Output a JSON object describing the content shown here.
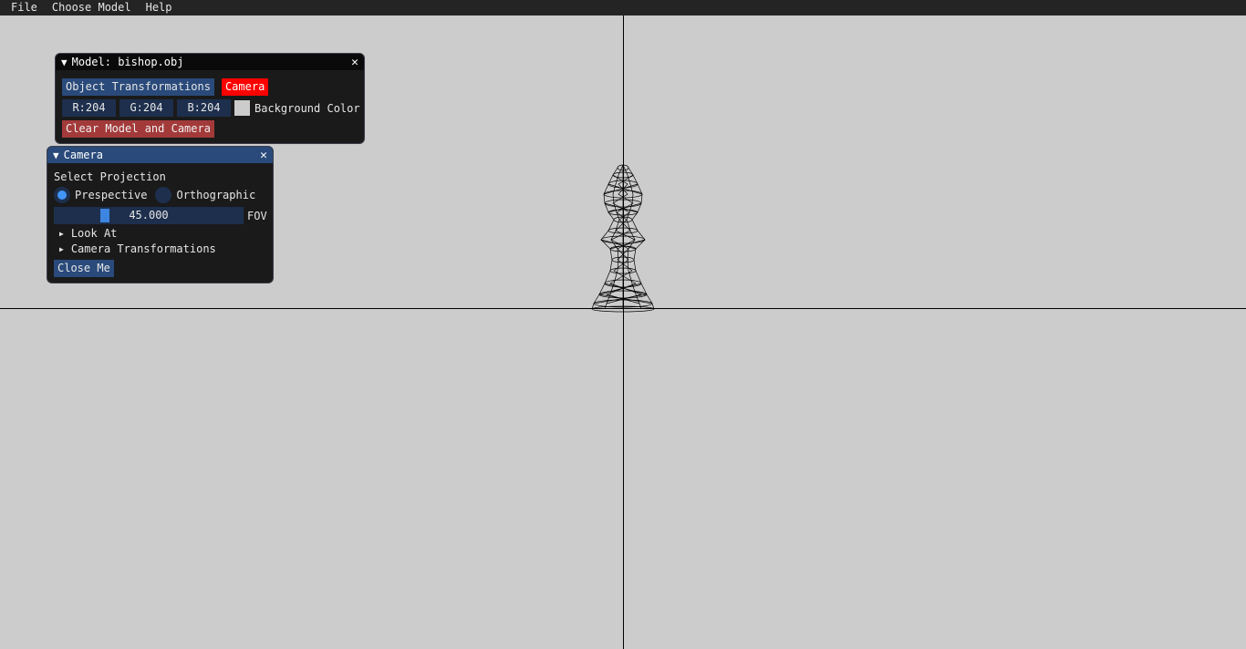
{
  "menubar": {
    "items": [
      "File",
      "Choose Model",
      "Help"
    ]
  },
  "model_window": {
    "title": "Model: bishop.obj",
    "object_transformations_label": "Object Transformations",
    "camera_label": "Camera",
    "r_label": "R:204",
    "g_label": "G:204",
    "b_label": "B:204",
    "background_color_label": "Background Color",
    "background_color": "#cccccc",
    "clear_label": "Clear Model and Camera"
  },
  "camera_window": {
    "title": "Camera",
    "select_projection_label": "Select Projection",
    "perspective_label": "Prespective",
    "orthographic_label": "Orthographic",
    "selected_projection": "Prespective",
    "fov_value": "45.000",
    "fov_label": "FOV",
    "look_at_label": "Look At",
    "camera_transformations_label": "Camera Transformations",
    "close_label": "Close Me"
  },
  "colors": {
    "background": "#cccccc",
    "accent": "#294a7a",
    "camera_button": "#ff0000",
    "clear_button": "#a33a3a"
  }
}
